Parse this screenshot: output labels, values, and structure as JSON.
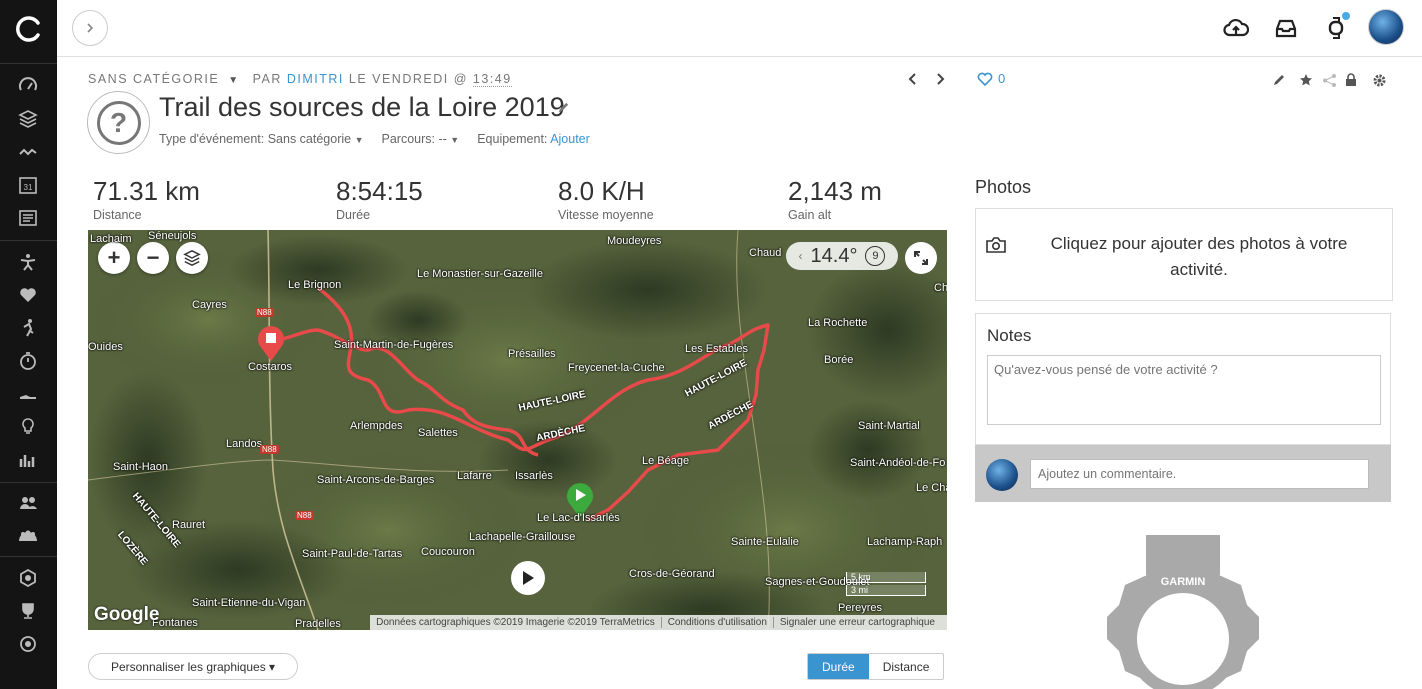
{
  "topbar": {
    "notification_dot_color": "#4aa9e9"
  },
  "activity": {
    "category_label": "SANS CATÉGORIE",
    "by_label": "PAR",
    "author": "DIMITRI",
    "day_label": "LE VENDREDI @",
    "time": "13:49",
    "title": "Trail des sources de la Loire 2019",
    "event_type_label": "Type d'événement: Sans catégorie",
    "course_label": "Parcours: --",
    "equipment_label": "Equipement:",
    "equipment_action": "Ajouter",
    "likes": "0"
  },
  "stats": [
    {
      "value": "71.31 km",
      "label": "Distance"
    },
    {
      "value": "8:54:15",
      "label": "Durée"
    },
    {
      "value": "8.0 K/H",
      "label": "Vitesse moyenne"
    },
    {
      "value": "2,143 m",
      "label": "Gain alt"
    }
  ],
  "map": {
    "angle": "14.4°",
    "compass": "9",
    "attribution": "Données cartographiques ©2019 Imagerie ©2019 TerraMetrics",
    "terms": "Conditions d'utilisation",
    "report": "Signaler une erreur cartographique",
    "scale_km": "5 km",
    "scale_mi": "3 mi",
    "logo": "Google",
    "labels": {
      "lachaim": "Lachaim",
      "seneujols": "Séneujols",
      "moudeyres": "Moudeyres",
      "chaud": "Chaud",
      "monastier": "Le Monastier-sur-Gazeille",
      "brignon": "Le Brignon",
      "cayres": "Cayres",
      "larochette": "La Rochette",
      "ouides": "Ouides",
      "costaros": "Costaros",
      "stmartin": "Saint-Martin-de-Fugères",
      "presailles": "Présailles",
      "freycenet": "Freycenet-la-Cuche",
      "estables": "Les Estables",
      "boree": "Borée",
      "arlempdes": "Arlempdes",
      "salettes": "Salettes",
      "stmartial": "Saint-Martial",
      "sthaon": "Saint-Haon",
      "landos": "Landos",
      "lebeage": "Le Béage",
      "standeol": "Saint-Andéol-de-Fo",
      "starcons": "Saint-Arcons-de-Barges",
      "lafarre": "Lafarre",
      "issarles": "Issarlès",
      "lecham": "Le Cham",
      "rauret": "Rauret",
      "lelac": "Le Lac-d'Issarlès",
      "lachapelle": "Lachapelle-Graillouse",
      "steulalie": "Sainte-Eulalie",
      "lachamp": "Lachamp-Raph",
      "stpaul": "Saint-Paul-de-Tartas",
      "coucouron": "Coucouron",
      "crosgeorand": "Cros-de-Géorand",
      "sagnes": "Sagnes-et-Goudoulet",
      "stetienne": "Saint-Etienne-du-Vigan",
      "pereyres": "Pereyres",
      "fontanes": "Fontanes",
      "pradelles": "Pradelles",
      "ch": "Ch"
    },
    "regions": {
      "hl1": "HAUTE-LOIRE",
      "ardeche1": "ARDÈCHE",
      "hl2": "HAUTE-LOIRE",
      "ardeche2": "ARDÈCHE",
      "hl3": "HAUTE-LOIRE",
      "lozere": "LOZÈRE"
    },
    "roads": {
      "n88a": "N88",
      "n88b": "N88",
      "n88c": "N88"
    }
  },
  "charts": {
    "customize_label": "Personnaliser les graphiques ▾",
    "tab_duration": "Durée",
    "tab_distance": "Distance"
  },
  "photos": {
    "title": "Photos",
    "prompt": "Cliquez pour ajouter des photos à votre activité."
  },
  "notes": {
    "title": "Notes",
    "placeholder": "Qu'avez-vous pensé de votre activité ?"
  },
  "comment": {
    "placeholder": "Ajoutez un commentaire."
  },
  "device": {
    "brand": "GARMIN"
  }
}
